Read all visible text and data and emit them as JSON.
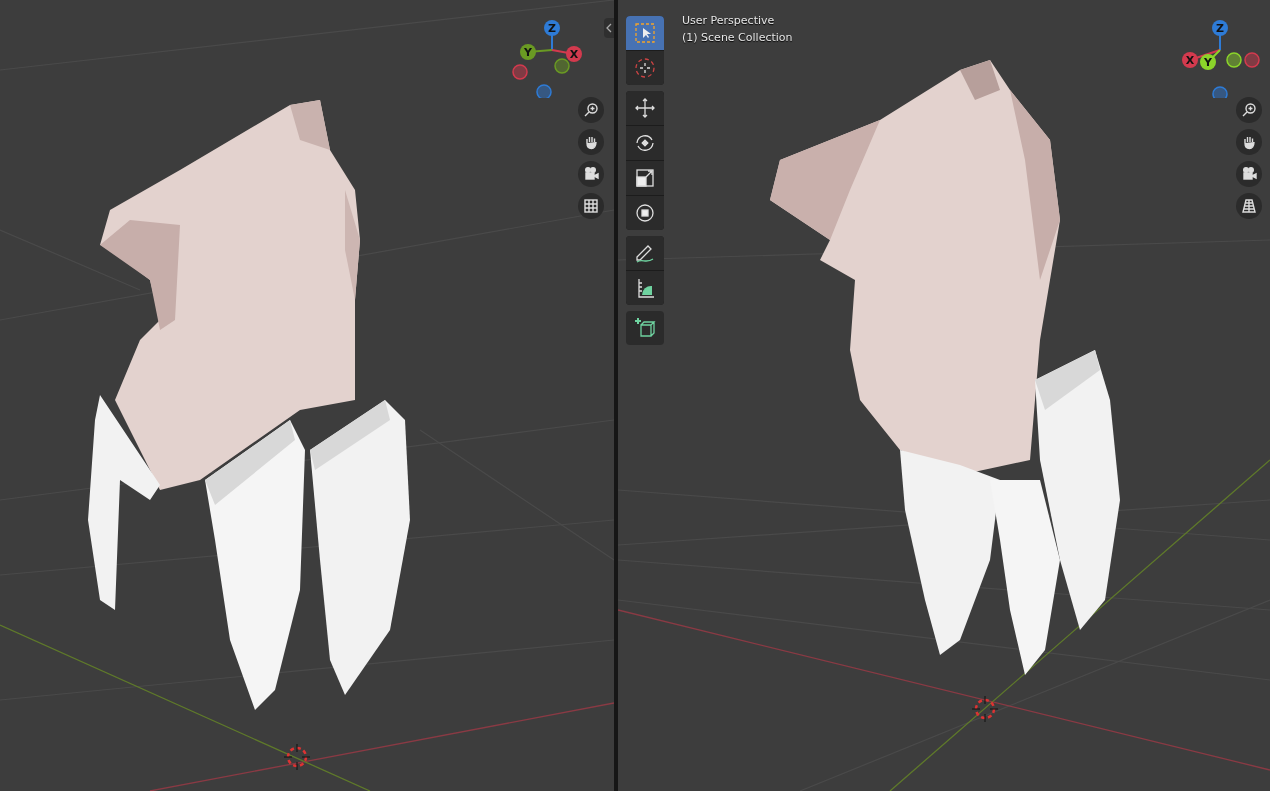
{
  "viewports": [
    {
      "gizmo": [
        {
          "label": "Z",
          "color": "#2e7bd6"
        },
        {
          "label": "Y",
          "color": "#6a9a23"
        },
        {
          "label": "X",
          "color": "#d33a4e"
        }
      ],
      "sidebar_toggle": true
    },
    {
      "header": [
        "User Perspective",
        "(1) Scene Collection"
      ],
      "gizmo": [
        {
          "label": "Z",
          "color": "#2e7bd6"
        },
        {
          "label": "X",
          "color": "#d33a4e"
        },
        {
          "label": "Y",
          "color": "#8bd42a"
        }
      ],
      "sidebar_toggle": false,
      "toolbar": [
        {
          "kind": "select",
          "selected": true
        },
        {
          "kind": "cursor",
          "selected": false
        },
        {
          "kind": "move",
          "selected": false
        },
        {
          "kind": "rotate",
          "selected": false
        },
        {
          "kind": "scale",
          "selected": false
        },
        {
          "kind": "transform",
          "selected": false
        },
        {
          "kind": "annotate",
          "selected": false
        },
        {
          "kind": "measure",
          "selected": false
        },
        {
          "kind": "add",
          "selected": false
        }
      ]
    }
  ]
}
